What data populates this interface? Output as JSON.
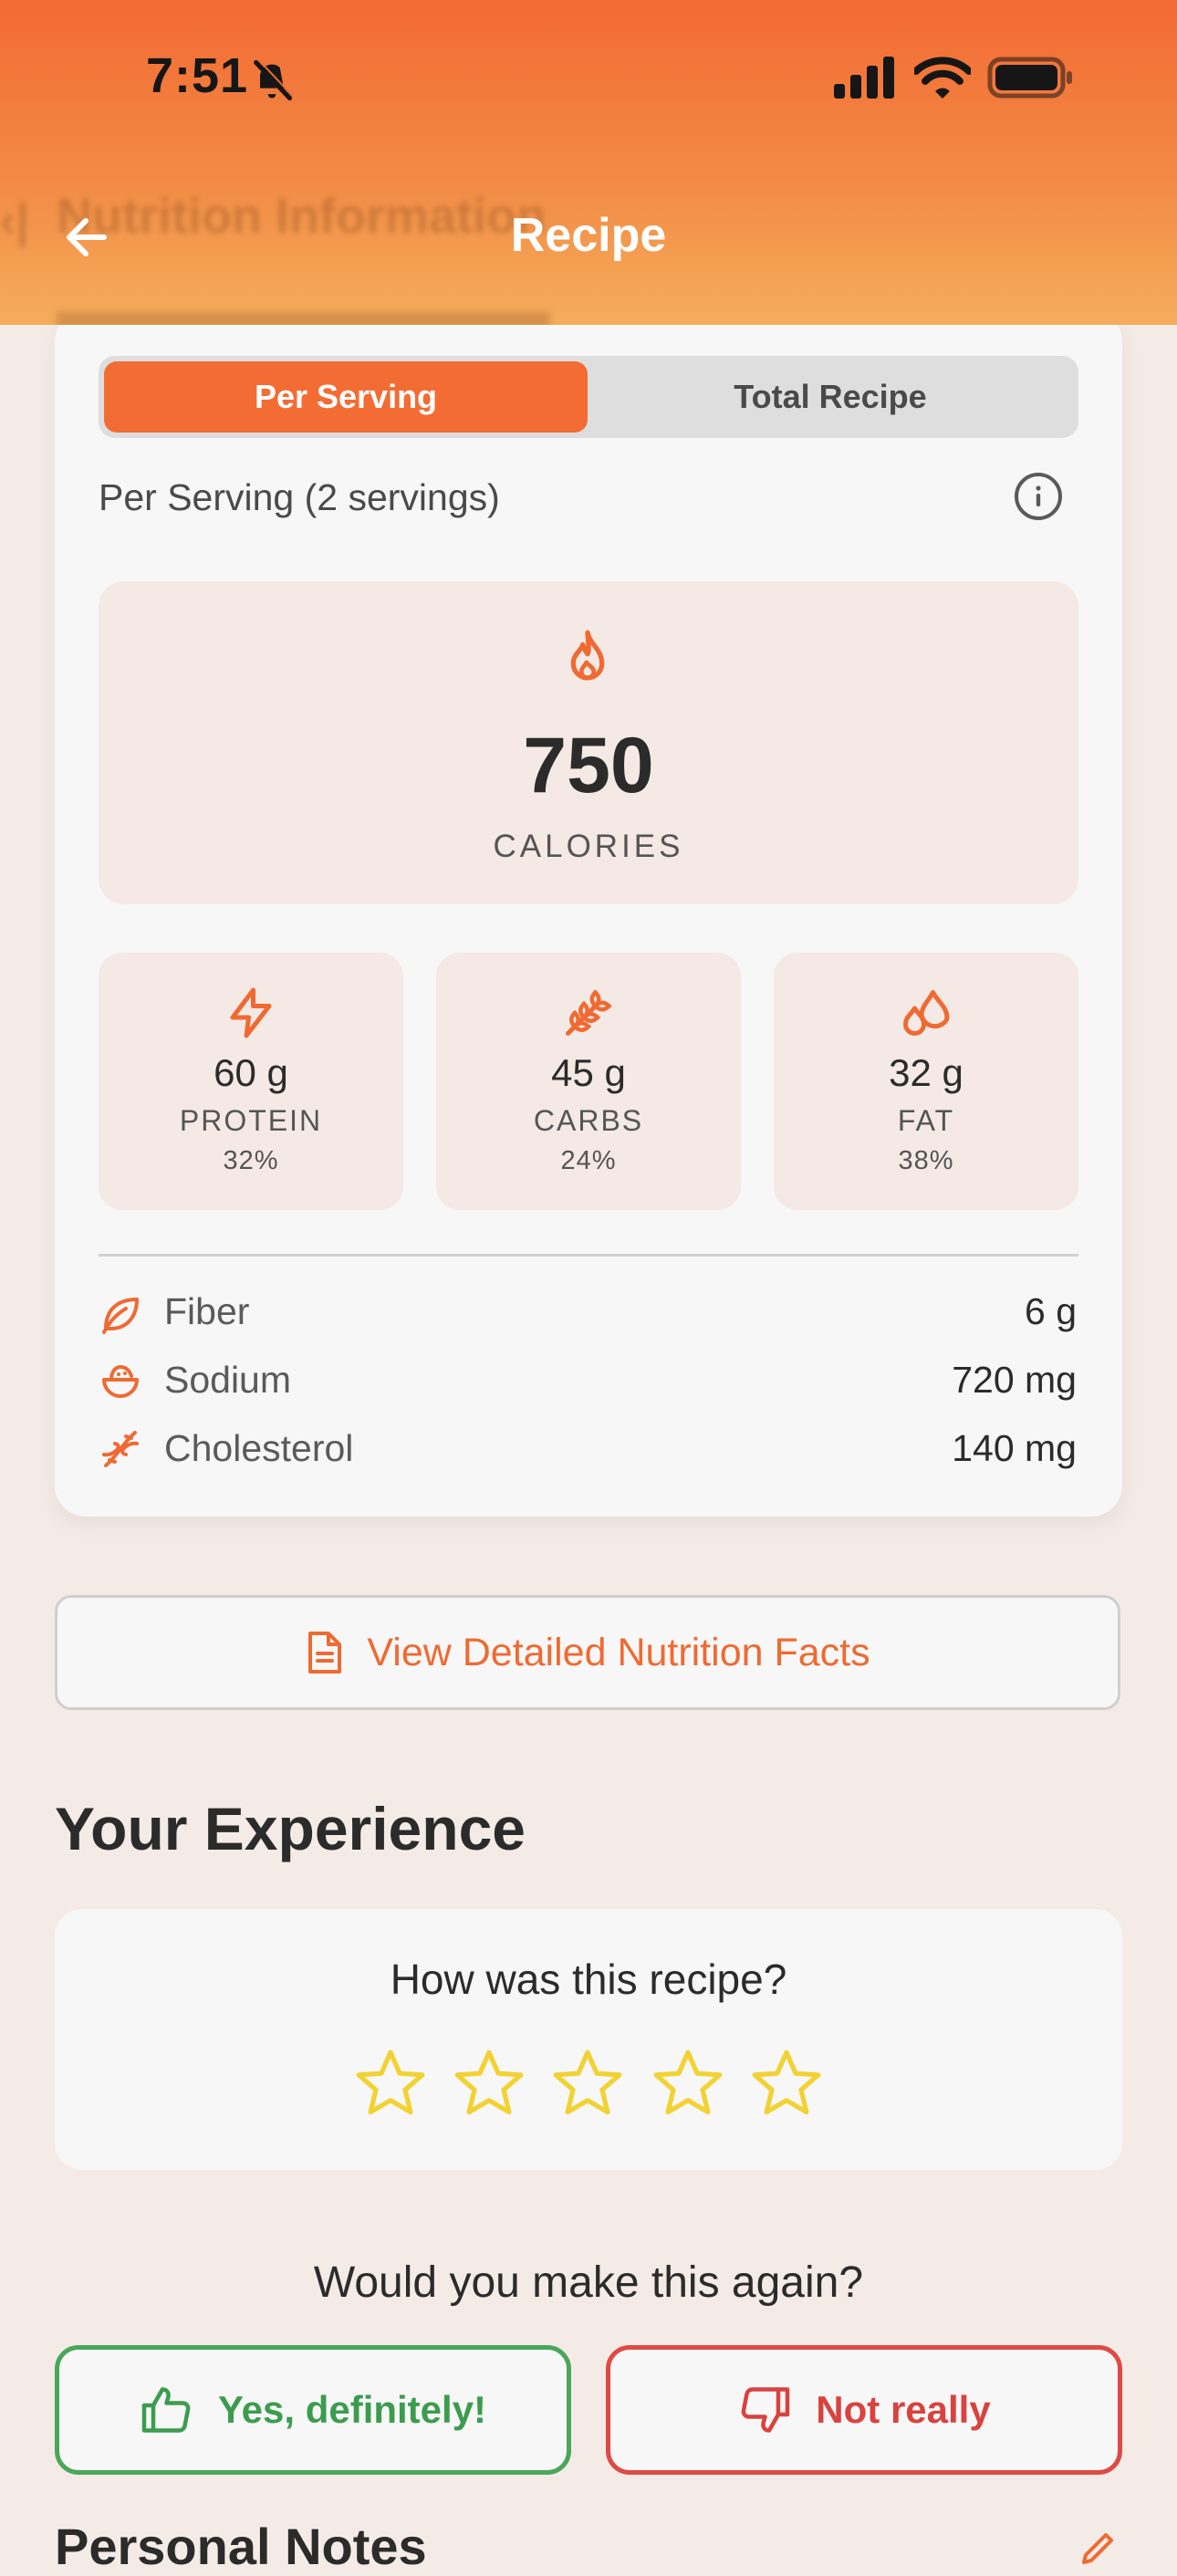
{
  "status_bar": {
    "time": "7:51"
  },
  "header": {
    "title": "Recipe",
    "ghost_title": "Nutrition Information",
    "accent": "#f36c33"
  },
  "nutrition": {
    "tabs": [
      {
        "label": "Per Serving",
        "selected": true
      },
      {
        "label": "Total Recipe",
        "selected": false
      }
    ],
    "servings_label": "Per Serving (2 servings)",
    "calories": {
      "value": "750",
      "label": "CALORIES"
    },
    "macros": [
      {
        "value": "60 g",
        "label": "PROTEIN",
        "percent": "32%",
        "icon": "bolt-icon"
      },
      {
        "value": "45 g",
        "label": "CARBS",
        "percent": "24%",
        "icon": "wheat-icon"
      },
      {
        "value": "32 g",
        "label": "FAT",
        "percent": "38%",
        "icon": "droplets-icon"
      }
    ],
    "details": [
      {
        "label": "Fiber",
        "value": "6 g",
        "icon": "leaf-icon"
      },
      {
        "label": "Sodium",
        "value": "720 mg",
        "icon": "salt-icon"
      },
      {
        "label": "Cholesterol",
        "value": "140 mg",
        "icon": "dna-icon"
      }
    ],
    "detail_button": "View Detailed Nutrition Facts"
  },
  "experience": {
    "title": "Your Experience",
    "rating_question": "How was this recipe?",
    "rating": 0,
    "rating_max": 5,
    "make_again_question": "Would you make this again?",
    "yes_label": "Yes, definitely!",
    "no_label": "Not really"
  },
  "notes": {
    "title": "Personal Notes"
  },
  "colors": {
    "accent": "#f36c33",
    "star": "#f2d233",
    "yes": "#4aa75a",
    "no": "#df4a45"
  }
}
